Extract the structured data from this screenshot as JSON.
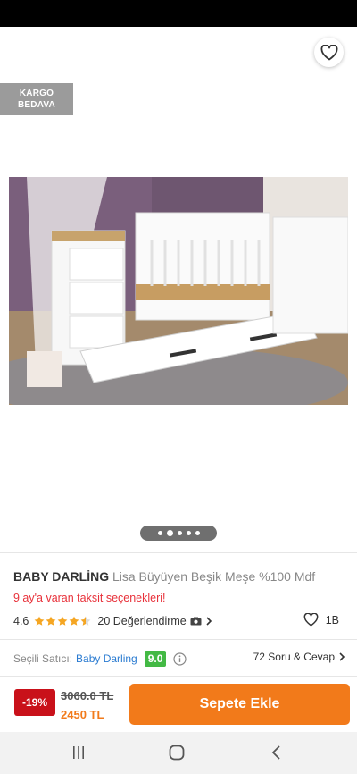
{
  "header": {
    "back_icon": "arrow-left-icon",
    "share_icon": "share-icon",
    "favorite_icon": "heart-outline-icon"
  },
  "cargo_badge": {
    "line1": "KARGO",
    "line2": "BEDAVA"
  },
  "gallery": {
    "page_count": 5,
    "active_index": 1
  },
  "product": {
    "brand": "BABY DARLİNG",
    "name": "Lisa Büyüyen Beşik Meşe %100 Mdf",
    "installment_text": "9 ay'a varan taksit seçenekleri!",
    "rating": "4.6",
    "rating_value": 4.6,
    "reviews_text": "20 Değerlendirme",
    "like_count": "1B"
  },
  "seller": {
    "label": "Seçili Satıcı:",
    "name": "Baby Darling",
    "score": "9.0",
    "qa_text": "72 Soru & Cevap"
  },
  "purchase": {
    "discount": "-19%",
    "old_price": "3060.0 TL",
    "new_price": "2450 TL",
    "cart_label": "Sepete Ekle"
  },
  "colors": {
    "accent": "#f27a1a",
    "discount_bg": "#c9111a",
    "installment": "#e8313a",
    "seller_link": "#2a7bd1",
    "score_bg": "#43b944",
    "star": "#f5a623"
  }
}
